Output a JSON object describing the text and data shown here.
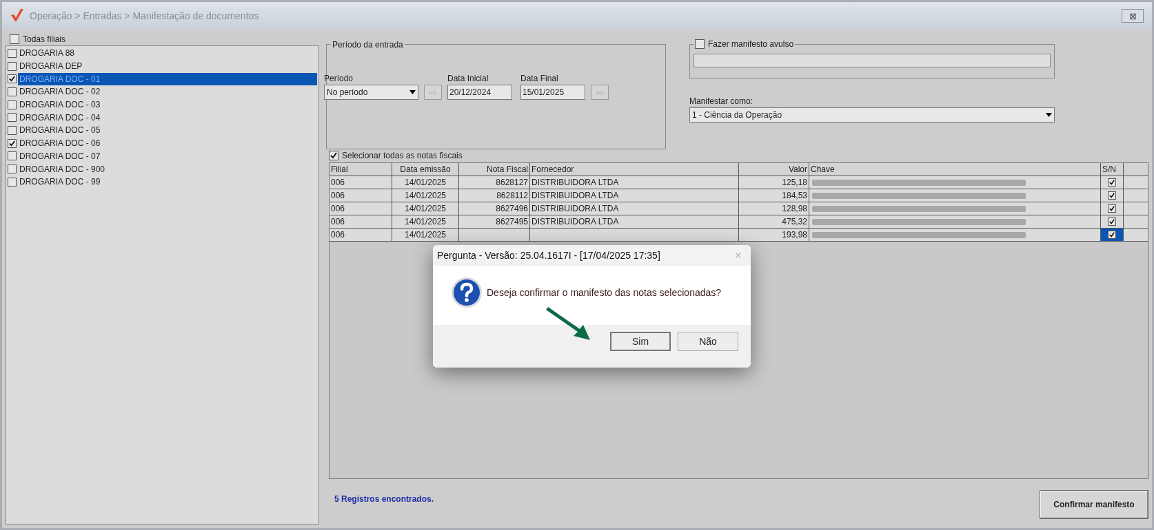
{
  "window": {
    "title": "Operação > Entradas > Manifestação de documentos",
    "close": "⊠"
  },
  "all_branches": {
    "label": "Todas filiais",
    "checked": false
  },
  "branches": [
    {
      "label": "DROGARIA 88",
      "checked": false,
      "selected": false
    },
    {
      "label": "DROGARIA DEP",
      "checked": false,
      "selected": false
    },
    {
      "label": "DROGARIA DOC - 01",
      "checked": true,
      "selected": true
    },
    {
      "label": "DROGARIA DOC - 02",
      "checked": false,
      "selected": false
    },
    {
      "label": "DROGARIA DOC - 03",
      "checked": false,
      "selected": false
    },
    {
      "label": "DROGARIA DOC - 04",
      "checked": false,
      "selected": false
    },
    {
      "label": "DROGARIA DOC - 05",
      "checked": false,
      "selected": false
    },
    {
      "label": "DROGARIA DOC - 06",
      "checked": true,
      "selected": false
    },
    {
      "label": "DROGARIA DOC - 07",
      "checked": false,
      "selected": false
    },
    {
      "label": "DROGARIA DOC - 900",
      "checked": false,
      "selected": false
    },
    {
      "label": "DROGARIA DOC - 99",
      "checked": false,
      "selected": false
    }
  ],
  "period_group": {
    "title": "Período da entrada",
    "period_label": "Período",
    "period_value": "No período",
    "prev_button": "<<",
    "start_label": "Data Inicial",
    "start_value": "20/12/2024",
    "end_label": "Data Final",
    "end_value": "15/01/2025",
    "next_button": ">>"
  },
  "single_manifest": {
    "label": "Fazer manifesto avulso",
    "checked": false
  },
  "manifest_as": {
    "label": "Manifestar como:",
    "value": "1 - Ciência da Operação"
  },
  "select_all": {
    "label": "Selecionar todas as notas fiscais",
    "checked": true
  },
  "table": {
    "columns": [
      "Filial",
      "Data emissão",
      "Nota Fiscal",
      "Fornecedor",
      "Valor",
      "Chave",
      "S/N"
    ],
    "rows": [
      {
        "filial": "006",
        "data": "14/01/2025",
        "nota": "8628127",
        "fornecedor": "DISTRIBUIDORA  LTDA",
        "valor": "125,18",
        "checked": true,
        "selected": false
      },
      {
        "filial": "006",
        "data": "14/01/2025",
        "nota": "8628112",
        "fornecedor": "DISTRIBUIDORA  LTDA",
        "valor": "184,53",
        "checked": true,
        "selected": false
      },
      {
        "filial": "006",
        "data": "14/01/2025",
        "nota": "8627496",
        "fornecedor": "DISTRIBUIDORA  LTDA",
        "valor": "128,98",
        "checked": true,
        "selected": false
      },
      {
        "filial": "006",
        "data": "14/01/2025",
        "nota": "8627495",
        "fornecedor": "DISTRIBUIDORA  LTDA",
        "valor": "475,32",
        "checked": true,
        "selected": false
      },
      {
        "filial": "006",
        "data": "14/01/2025",
        "valor": "193,98",
        "checked": true,
        "selected": true
      }
    ]
  },
  "status": "5 Registros encontrados.",
  "confirm_button": "Confirmar manifesto",
  "dialog": {
    "title": "Pergunta - Versão: 25.04.1617I - [17/04/2025 17:35]",
    "close": "✕",
    "message": "Deseja confirmar o manifesto das notas selecionadas?",
    "buttons": [
      {
        "label": "Sim",
        "default": true
      },
      {
        "label": "Não",
        "default": false
      }
    ]
  }
}
